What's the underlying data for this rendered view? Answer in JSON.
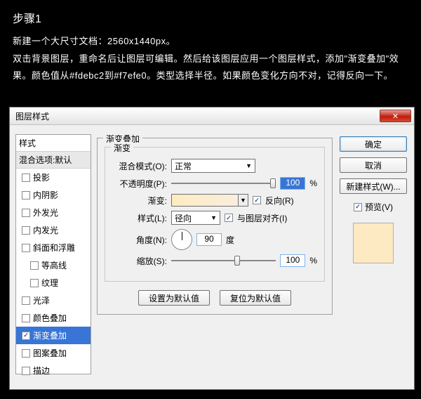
{
  "step": {
    "title": "步骤1",
    "line1": "新建一个大尺寸文档：2560x1440px。",
    "line2": "双击背景图层，重命名后让图层可编辑。然后给该图层应用一个图层样式，添加\"渐变叠加\"效果。颜色值从#fdebc2到#f7efe0。类型选择半径。如果颜色变化方向不对，记得反向一下。"
  },
  "dialog": {
    "title": "图层样式",
    "close": "✕"
  },
  "styles": {
    "header": "样式",
    "blend": "混合选项:默认",
    "items": [
      {
        "label": "投影",
        "checked": false,
        "indent": false
      },
      {
        "label": "内阴影",
        "checked": false,
        "indent": false
      },
      {
        "label": "外发光",
        "checked": false,
        "indent": false
      },
      {
        "label": "内发光",
        "checked": false,
        "indent": false
      },
      {
        "label": "斜面和浮雕",
        "checked": false,
        "indent": false
      },
      {
        "label": "等高线",
        "checked": false,
        "indent": true
      },
      {
        "label": "纹理",
        "checked": false,
        "indent": true
      },
      {
        "label": "光泽",
        "checked": false,
        "indent": false
      },
      {
        "label": "颜色叠加",
        "checked": false,
        "indent": false
      },
      {
        "label": "渐变叠加",
        "checked": true,
        "indent": false,
        "selected": true
      },
      {
        "label": "图案叠加",
        "checked": false,
        "indent": false
      },
      {
        "label": "描边",
        "checked": false,
        "indent": false
      }
    ]
  },
  "panel": {
    "title": "渐变叠加",
    "group": "渐变",
    "blendMode": {
      "label": "混合模式(O):",
      "value": "正常"
    },
    "opacity": {
      "label": "不透明度(P):",
      "value": "100",
      "unit": "%"
    },
    "gradient": {
      "label": "渐变:",
      "reverse": "反向(R)"
    },
    "style": {
      "label": "样式(L):",
      "value": "径向",
      "align": "与图层对齐(I)"
    },
    "angle": {
      "label": "角度(N):",
      "value": "90",
      "unit": "度"
    },
    "scale": {
      "label": "缩放(S):",
      "value": "100",
      "unit": "%"
    },
    "setDefault": "设置为默认值",
    "resetDefault": "复位为默认值"
  },
  "right": {
    "ok": "确定",
    "cancel": "取消",
    "newStyle": "新建样式(W)...",
    "preview": "预览(V)"
  }
}
